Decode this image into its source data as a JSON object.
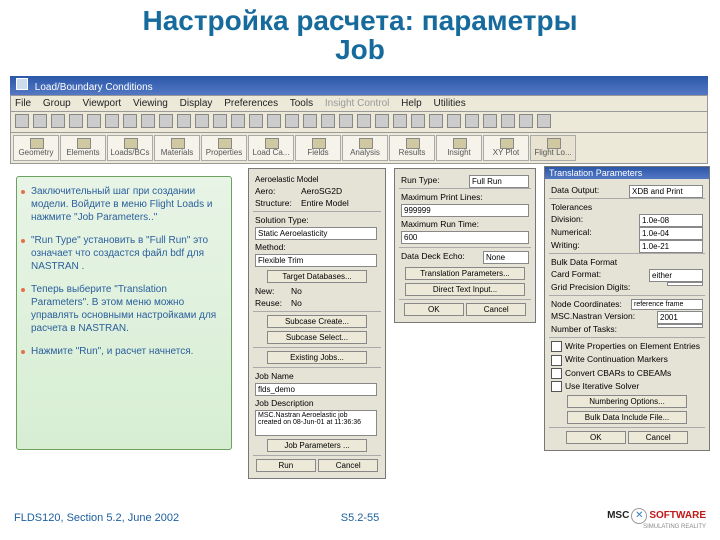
{
  "title_line1": "Настройка расчета: параметры",
  "title_line2": "Job",
  "app": {
    "titlebar": "Load/Boundary Conditions",
    "menu": [
      "File",
      "Group",
      "Viewport",
      "Viewing",
      "Display",
      "Preferences",
      "Tools",
      "Insight Control",
      "Help",
      "Utilities"
    ],
    "toolbar2": [
      "Geometry",
      "Elements",
      "Loads/BCs",
      "Materials",
      "Properties",
      "Load Ca...",
      "Fields",
      "Analysis",
      "Results",
      "Insight",
      "XY Plot",
      "Flight Lo..."
    ]
  },
  "bullets": [
    "Заключительный шаг при создании модели. Войдите в меню  Flight Loads и нажмите \"Job Parameters..\"",
    "\"Run Type\" установить в  \"Full Run\" это означает что создастся файл bdf для NASTRAN .",
    "Теперь выберите \"Translation Parameters\". В этом меню можно управлять основными настройками для расчета в NASTRAN.",
    "Нажмите \"Run\", и расчет начнется."
  ],
  "dlg1": {
    "aero_label": "Aeroelastic Model",
    "aero": "Aero:",
    "aero_val": "AeroSG2D",
    "struct": "Structure:",
    "struct_val": "Entire Model",
    "sol_type": "Solution Type:",
    "sol_type_val": "Static Aeroelasticity",
    "method": "Method:",
    "method_val": "Flexible Trim",
    "target_db": "Target Databases...",
    "new": "New:",
    "new_val": "No",
    "reuse": "Reuse:",
    "reuse_val": "No",
    "subcase_create": "Subcase Create...",
    "subcase_select": "Subcase Select...",
    "existing_jobs": "Existing Jobs...",
    "job_name_lbl": "Job Name",
    "job_name": "flds_demo",
    "job_desc_lbl": "Job Description",
    "job_desc": "MSC.Nastran Aeroelastic job\ncreated on 08-Jun-01 at 11:36:36",
    "job_params": "Job Parameters ...",
    "run": "Run",
    "cancel": "Cancel"
  },
  "dlg2": {
    "run_type": "Run Type:",
    "run_type_val": "Full Run",
    "max_print": "Maximum Print Lines:",
    "max_print_val": "999999",
    "max_run": "Maximum Run Time:",
    "max_run_val": "600",
    "echo": "Data Deck Echo:",
    "echo_val": "None",
    "trans": "Translation Parameters...",
    "direct": "Direct Text Input...",
    "ok": "OK",
    "cancel": "Cancel"
  },
  "dlg3": {
    "title": "Translation Parameters",
    "data_output": "Data Output:",
    "data_output_val": "XDB and Print",
    "tol": "Tolerances",
    "division": "Division:",
    "division_val": "1.0e-08",
    "numerical": "Numerical:",
    "numerical_val": "1.0e-04",
    "writing": "Writing:",
    "writing_val": "1.0e-21",
    "bulk": "Bulk Data Format",
    "card": "Card Format:",
    "card_val": "either",
    "grid": "Grid Precision Digits:",
    "node": "Node Coordinates:",
    "node_val": "reference frame",
    "ver": "MSC.Nastran Version:",
    "ver_val": "2001",
    "tasks": "Number of Tasks:",
    "ck1": "Write Properties on Element Entries",
    "ck2": "Write Continuation Markers",
    "ck3": "Convert CBARs to CBEAMs",
    "ck4": "Use Iterative Solver",
    "numopt": "Numbering Options...",
    "bulkinc": "Bulk Data Include File...",
    "ok": "OK",
    "cancel": "Cancel"
  },
  "footer_left": "FLDS120, Section 5.2, June 2002",
  "footer_center": "S5.2-55",
  "logo_msc": "MSC",
  "logo_soft": "SOFTWARE",
  "logo_tag": "SIMULATING REALITY"
}
